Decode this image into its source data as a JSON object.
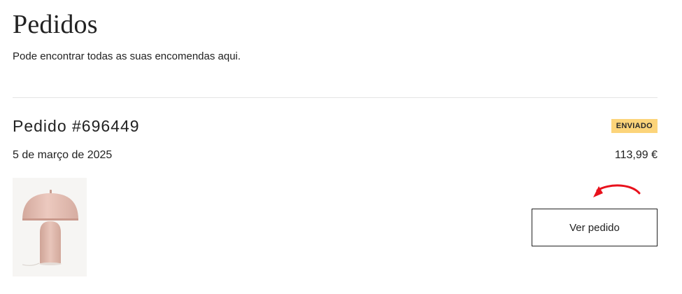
{
  "header": {
    "title": "Pedidos",
    "subtitle": "Pode encontrar todas as suas encomendas aqui."
  },
  "order": {
    "title": "Pedido #696449",
    "status": "ENVIADO",
    "date": "5 de março de 2025",
    "total": "113,99 €",
    "view_button_label": "Ver pedido",
    "product_image": "mushroom-table-lamp-pink"
  },
  "colors": {
    "status_badge_bg": "#fcd47a",
    "annotation_arrow": "#e8111c"
  }
}
